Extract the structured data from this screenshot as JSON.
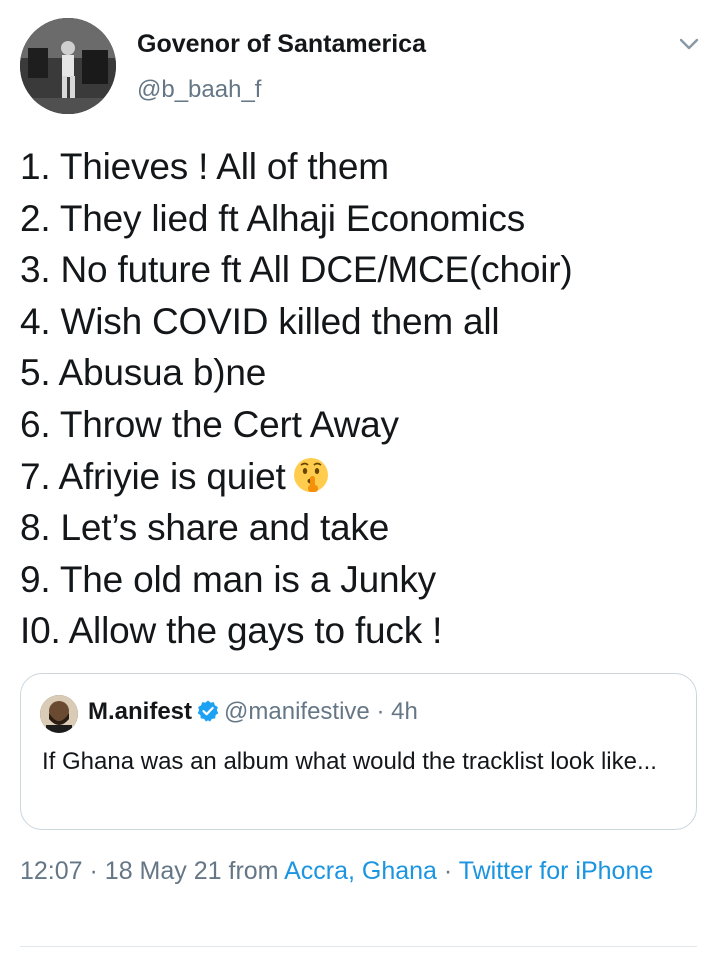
{
  "author": {
    "display_name": "Govenor of Santamerica",
    "handle": "@b_baah_f",
    "avatar_icon": "profile-photo"
  },
  "menu_icon": "chevron-down-icon",
  "tweet": {
    "lines": [
      "1. Thieves ! All of them",
      "2. They lied ft Alhaji Economics",
      "3. No future ft All DCE/MCE(choir)",
      "4. Wish COVID killed them all",
      "5. Abusua b)ne",
      "6. Throw the Cert Away",
      "7.  Afriyie is quiet",
      "8. Let’s share and take",
      "9. The old man is a Junky",
      "I0. Allow the gays to fuck !"
    ],
    "emoji": "shushing-face-emoji"
  },
  "quoted_tweet": {
    "name": "M.anifest",
    "verified_icon": "verified-badge-icon",
    "handle": "@manifestive",
    "separator": "·",
    "time": "4h",
    "text": "If Ghana was an album what would the tracklist look like..."
  },
  "meta": {
    "time": "12:07",
    "sep1": "·",
    "date": "18 May 21",
    "from": "from",
    "location": "Accra, Ghana",
    "sep2": "·",
    "client": "Twitter for iPhone"
  },
  "colors": {
    "text": "#14171a",
    "secondary": "#657786",
    "link": "#1b95e0",
    "border": "#ccd6dd"
  }
}
